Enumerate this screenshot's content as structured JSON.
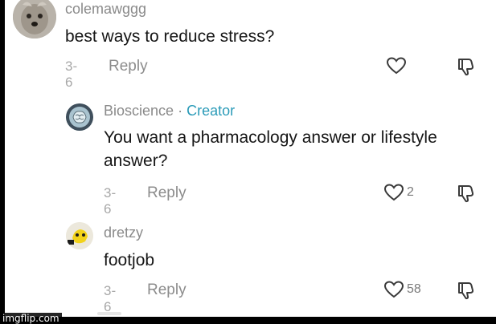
{
  "comments": [
    {
      "username": "colemawggg",
      "text": "best ways to reduce stress?",
      "date": "3-6",
      "reply_label": "Reply",
      "likes": ""
    },
    {
      "username": "Bioscience",
      "separator": "·",
      "badge": "Creator",
      "text": "You want a pharmacology answer or lifestyle answer?",
      "date": "3-6",
      "reply_label": "Reply",
      "likes": "2"
    },
    {
      "username": "dretzy",
      "text": "footjob",
      "date": "3-6",
      "reply_label": "Reply",
      "likes": "58"
    }
  ],
  "watermark": "imgflip.com",
  "icons": {
    "like": "heart-icon",
    "dislike": "thumbs-down-icon"
  },
  "colors": {
    "creator_accent": "#2b9bb8",
    "meta_gray": "#8a8a8a",
    "text": "#161616"
  }
}
